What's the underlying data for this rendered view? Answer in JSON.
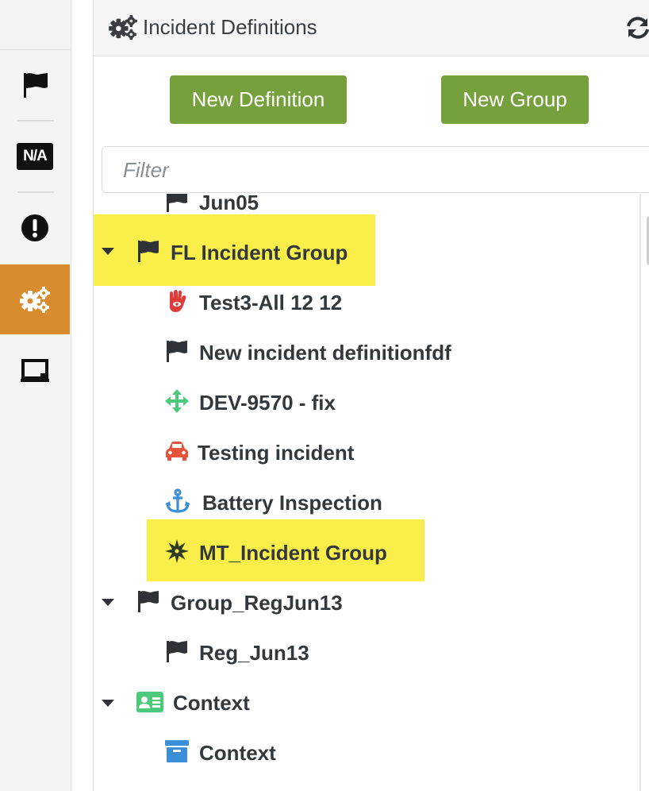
{
  "rail": {
    "items": [
      {
        "icon": "flag-icon",
        "active": false
      },
      {
        "icon": "na-badge-icon",
        "text": "N/A",
        "active": false
      },
      {
        "icon": "exclamation-circle-icon",
        "active": false
      },
      {
        "icon": "cogs-icon",
        "active": true
      },
      {
        "icon": "presentation-board-icon",
        "active": false
      }
    ],
    "active_color": "#d98c2e"
  },
  "panel": {
    "title": "Incident Definitions",
    "title_icon": "cogs-icon",
    "refresh_icon": "refresh-icon"
  },
  "buttons": {
    "new_definition": "New Definition",
    "new_group": "New Group",
    "color": "#76a03c"
  },
  "filter": {
    "placeholder": "Filter",
    "value": ""
  },
  "highlight_color": "#f9ee4a",
  "tree": {
    "rows": [
      {
        "label": "Jun05",
        "icon": "flag-icon",
        "level": 1
      },
      {
        "label": "FL Incident Group",
        "icon": "flag-icon",
        "level": 0,
        "expanded": true,
        "highlighted": true
      },
      {
        "label": "Test3-All 12 12",
        "icon": "hamsa-icon",
        "level": 1,
        "icon_color": "#e03b3b"
      },
      {
        "label": "New incident definitionfdf",
        "icon": "flag-icon",
        "level": 1
      },
      {
        "label": "DEV-9570 - fix",
        "icon": "arrows-move-icon",
        "level": 1,
        "icon_color": "#4cc97a"
      },
      {
        "label": "Testing incident",
        "icon": "car-icon",
        "level": 1,
        "icon_color": "#e5533c"
      },
      {
        "label": "Battery Inspection",
        "icon": "anchor-icon",
        "level": 1,
        "icon_color": "#3a8fd6"
      },
      {
        "label": "MT_Incident Group",
        "icon": "starburst-icon",
        "level": 1,
        "highlighted": true
      },
      {
        "label": "Group_RegJun13",
        "icon": "flag-icon",
        "level": 0,
        "expanded": true
      },
      {
        "label": "Reg_Jun13",
        "icon": "flag-icon",
        "level": 1
      },
      {
        "label": "Context",
        "icon": "id-card-icon",
        "level": 0,
        "expanded": true,
        "icon_color": "#4cc97a"
      },
      {
        "label": "Context",
        "icon": "archive-box-icon",
        "level": 1,
        "icon_color": "#3a8fd6"
      }
    ]
  }
}
